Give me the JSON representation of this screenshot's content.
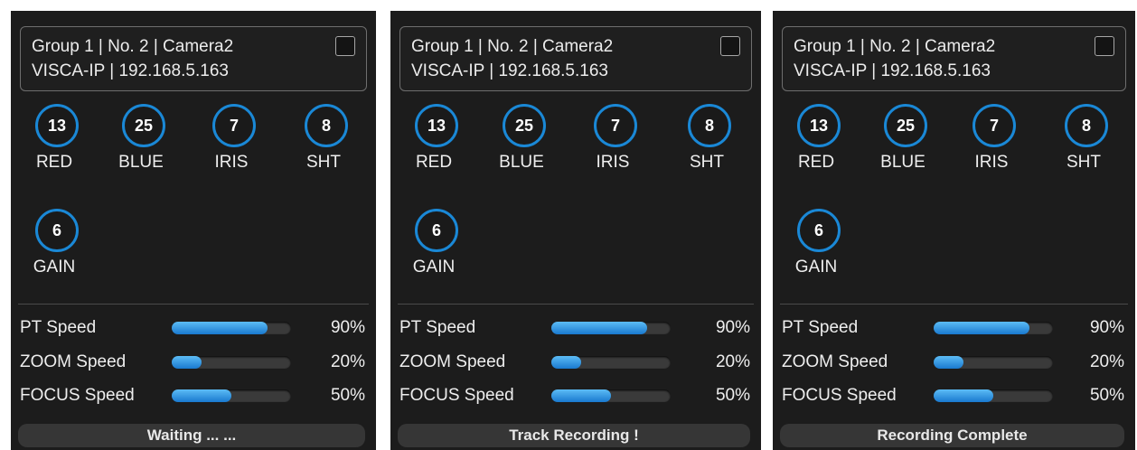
{
  "panels": [
    {
      "header": {
        "line1": "Group 1 | No. 2 | Camera2",
        "line2": "VISCA-IP | 192.168.5.163"
      },
      "dials": [
        {
          "value": "13",
          "label": "RED"
        },
        {
          "value": "25",
          "label": "BLUE"
        },
        {
          "value": "7",
          "label": "IRIS"
        },
        {
          "value": "8",
          "label": "SHT"
        },
        {
          "value": "6",
          "label": "GAIN"
        }
      ],
      "sliders": [
        {
          "label": "PT Speed",
          "value": "90%",
          "fraction": 0.8
        },
        {
          "label": "ZOOM Speed",
          "value": "20%",
          "fraction": 0.25
        },
        {
          "label": "FOCUS Speed",
          "value": "50%",
          "fraction": 0.5
        }
      ],
      "status": "Waiting ... ..."
    },
    {
      "header": {
        "line1": "Group 1 | No. 2 | Camera2",
        "line2": "VISCA-IP | 192.168.5.163"
      },
      "dials": [
        {
          "value": "13",
          "label": "RED"
        },
        {
          "value": "25",
          "label": "BLUE"
        },
        {
          "value": "7",
          "label": "IRIS"
        },
        {
          "value": "8",
          "label": "SHT"
        },
        {
          "value": "6",
          "label": "GAIN"
        }
      ],
      "sliders": [
        {
          "label": "PT Speed",
          "value": "90%",
          "fraction": 0.8
        },
        {
          "label": "ZOOM Speed",
          "value": "20%",
          "fraction": 0.25
        },
        {
          "label": "FOCUS Speed",
          "value": "50%",
          "fraction": 0.5
        }
      ],
      "status": "Track Recording !"
    },
    {
      "header": {
        "line1": "Group 1 | No. 2 | Camera2",
        "line2": "VISCA-IP | 192.168.5.163"
      },
      "dials": [
        {
          "value": "13",
          "label": "RED"
        },
        {
          "value": "25",
          "label": "BLUE"
        },
        {
          "value": "7",
          "label": "IRIS"
        },
        {
          "value": "8",
          "label": "SHT"
        },
        {
          "value": "6",
          "label": "GAIN"
        }
      ],
      "sliders": [
        {
          "label": "PT Speed",
          "value": "90%",
          "fraction": 0.8
        },
        {
          "label": "ZOOM Speed",
          "value": "20%",
          "fraction": 0.25
        },
        {
          "label": "FOCUS Speed",
          "value": "50%",
          "fraction": 0.5
        }
      ],
      "status": "Recording Complete"
    }
  ],
  "colors": {
    "dial_ring": "#1a88d6",
    "slider_fill": "#2a96e2",
    "panel_bg": "#1c1c1c"
  }
}
